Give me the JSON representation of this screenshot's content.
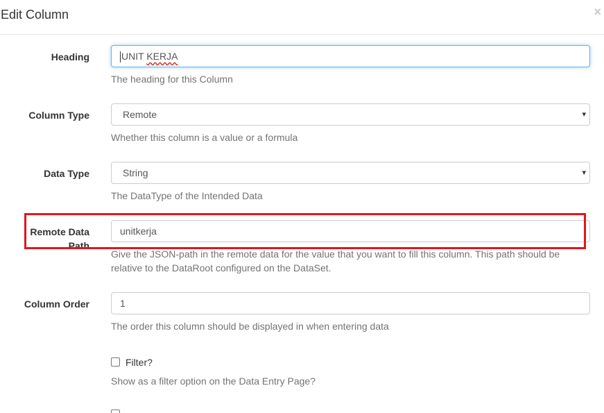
{
  "dialog": {
    "title": "Edit Column",
    "close_symbol": "×"
  },
  "fields": {
    "heading": {
      "label": "Heading",
      "value_prefix": "UNIT ",
      "value_spell": "KERJA",
      "help": "The heading for this Column"
    },
    "column_type": {
      "label": "Column Type",
      "selected": "Remote",
      "help": "Whether this column is a value or a formula"
    },
    "data_type": {
      "label": "Data Type",
      "selected": "String",
      "help": "The DataType of the Intended Data"
    },
    "remote_data_path": {
      "label_line1": "Remote Data",
      "label_line2": "Path",
      "value": "unitkerja",
      "help_line1": "Give the JSON-path in the remote data for the value that you want to fill this column. This path should be",
      "help_line2": "relative to the DataRoot configured on the DataSet."
    },
    "column_order": {
      "label": "Column Order",
      "value": "1",
      "help": "The order this column should be displayed in when entering data"
    },
    "filter": {
      "label": "Filter?",
      "help": "Show as a filter option on the Data Entry Page?"
    }
  },
  "icons": {
    "select_caret": "▾"
  },
  "colors": {
    "highlight": "#e0161d",
    "focus_border": "#66afe9"
  }
}
